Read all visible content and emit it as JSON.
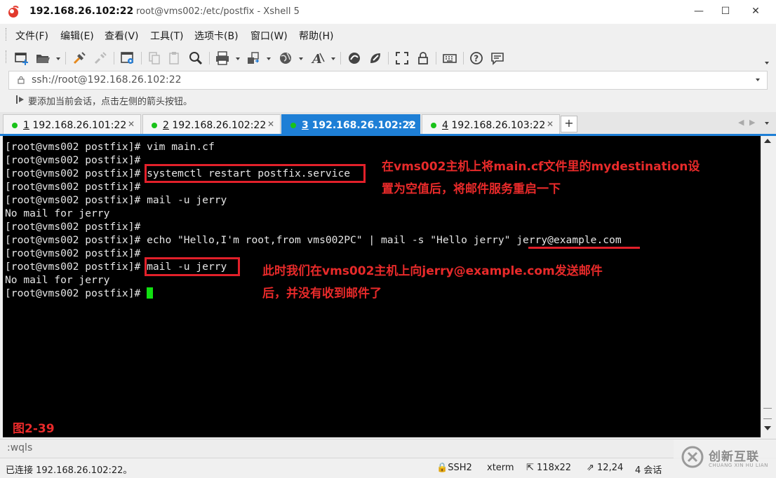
{
  "window": {
    "host": "192.168.26.102:22",
    "title": "root@vms002:/etc/postfix - Xshell 5"
  },
  "menu": [
    "文件(F)",
    "编辑(E)",
    "查看(V)",
    "工具(T)",
    "选项卡(B)",
    "窗口(W)",
    "帮助(H)"
  ],
  "address": {
    "value": "ssh://root@192.168.26.102:22"
  },
  "info": {
    "text": "要添加当前会话，点击左侧的箭头按钮。"
  },
  "tabs": [
    {
      "num": "1",
      "label": "192.168.26.101:22",
      "active": false
    },
    {
      "num": "2",
      "label": "192.168.26.102:22",
      "active": false
    },
    {
      "num": "3",
      "label": "192.168.26.102:22",
      "active": true
    },
    {
      "num": "4",
      "label": "192.168.26.103:22",
      "active": false
    }
  ],
  "tab_add": "+",
  "terminal": {
    "lines": [
      "[root@vms002 postfix]# vim main.cf",
      "[root@vms002 postfix]#",
      "[root@vms002 postfix]# systemctl restart postfix.service",
      "[root@vms002 postfix]#",
      "[root@vms002 postfix]# mail -u jerry",
      "No mail for jerry",
      "[root@vms002 postfix]#",
      "[root@vms002 postfix]# echo \"Hello,I'm root,from vms002PC\" | mail -s \"Hello jerry\" jerry@example.com",
      "[root@vms002 postfix]#",
      "[root@vms002 postfix]# mail -u jerry",
      "No mail for jerry",
      "[root@vms002 postfix]# "
    ]
  },
  "annotations": {
    "note1_line1": "在vms002主机上将main.cf文件里的mydestination设",
    "note1_line2": "置为空值后，将邮件服务重启一下",
    "note2_line1": "此时我们在vms002主机上向jerry@example.com发送邮件",
    "note2_line2": "后，并没有收到邮件了",
    "figure": "图2-39",
    "color": "#e2202a"
  },
  "command_bar": {
    "text": ":wqls"
  },
  "status": {
    "connection": "已连接 192.168.26.102:22。",
    "protocol": "SSH2",
    "term": "xterm",
    "size": "118x22",
    "cursor_pos": "12,24",
    "sessions": "4 会话"
  },
  "watermark": {
    "text": "创新互联",
    "sub": "CHUANG XIN HU LIAN"
  }
}
